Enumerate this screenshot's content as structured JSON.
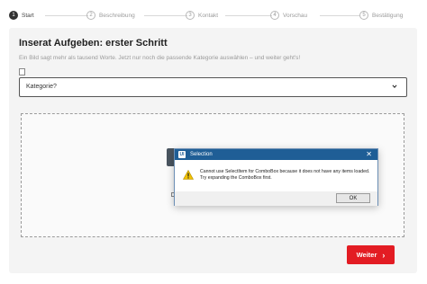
{
  "stepper": {
    "steps": [
      {
        "number": "1",
        "label": "Start",
        "active": true
      },
      {
        "number": "2",
        "label": "Beschreibung",
        "active": false
      },
      {
        "number": "3",
        "label": "Kontakt",
        "active": false
      },
      {
        "number": "4",
        "label": "Vorschau",
        "active": false
      },
      {
        "number": "5",
        "label": "Bestätigung",
        "active": false
      }
    ]
  },
  "main": {
    "title": "Inserat Aufgeben: erster Schritt",
    "subtitle": "Ein Bild sagt mehr als tausend Worte. Jetzt nur noch die passende Kategorie auswählen – und weiter geht's!",
    "category_select": {
      "value": "Kategorie?",
      "icon": "chevron-down-icon"
    },
    "next_button": {
      "label": "Weiter",
      "icon": "chevron-right-icon"
    }
  },
  "dialog": {
    "title": "Selection",
    "app_icon": "app-icon",
    "close_icon": "close-icon",
    "warning_icon": "warning-icon",
    "message_line1": "Cannot use SelectItem for ComboBox because it does not have any items loaded.",
    "message_line2": "Try expanding the ComboBox first.",
    "ok_label": "OK"
  },
  "colors": {
    "accent_red": "#e31c23",
    "dialog_titlebar": "#1f5e96",
    "card_background": "#f4f4f4",
    "warning_yellow": "#f2c200"
  }
}
